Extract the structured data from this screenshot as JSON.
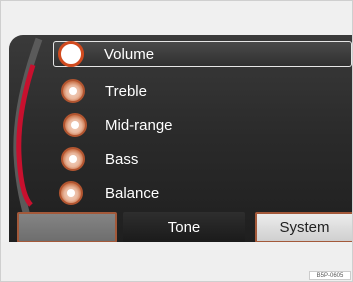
{
  "menu": {
    "items": [
      {
        "label": "Volume",
        "selected": true
      },
      {
        "label": "Treble",
        "selected": false
      },
      {
        "label": "Mid-range",
        "selected": false
      },
      {
        "label": "Bass",
        "selected": false
      },
      {
        "label": "Balance",
        "selected": false
      }
    ]
  },
  "buttons": {
    "left_label": "",
    "tone_label": "Tone",
    "system_label": "System"
  },
  "image_code": "B5P-0605",
  "colors": {
    "accent": "#d14a1e",
    "arc": "#c8102e",
    "screen": "#2a2a2a"
  }
}
